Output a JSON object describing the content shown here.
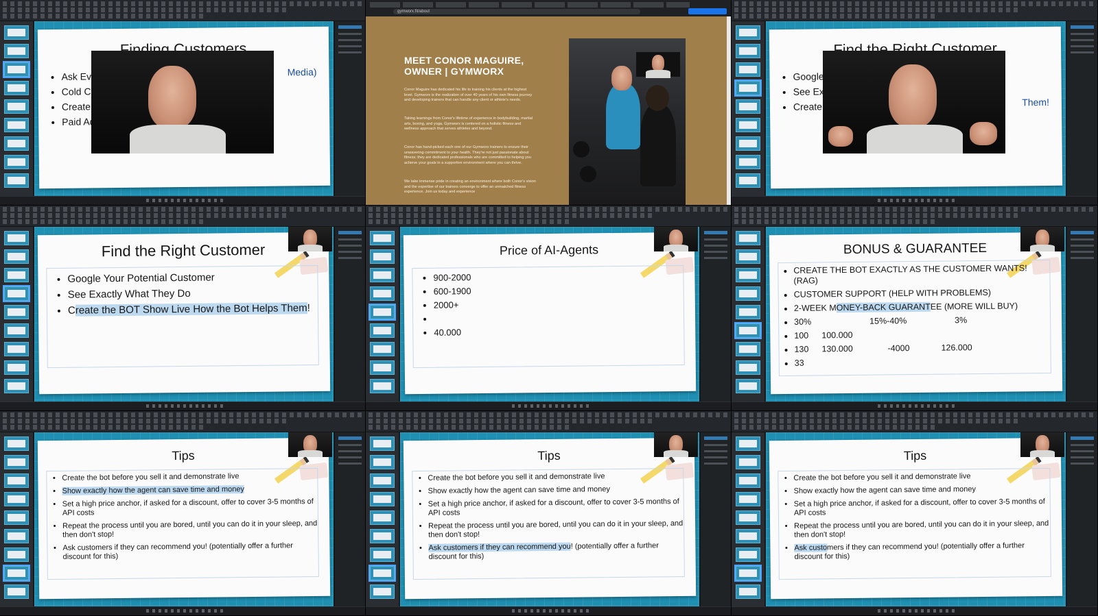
{
  "tiles": {
    "t1": {
      "title": "Finding Customers",
      "bullets": [
        "Ask Eve",
        "Cold Ca",
        "Create C",
        "Paid Adv"
      ],
      "right_fragment": "Media)"
    },
    "t2": {
      "url": "gymworx.fit/about",
      "heading": "MEET CONOR MAGUIRE, OWNER | GYMWORX",
      "paragraphs": [
        "Conor Maguire has dedicated his life to training his clients at the highest level. Gymworx is the realization of over 40 years of his own fitness journey and developing trainers that can handle any client or athlete's needs.",
        "Taking learnings from Conor's lifetime of experience in bodybuilding, martial arts, boxing, and yoga, Gymworx is centered on a holistic fitness and wellness approach that serves athletes and beyond.",
        "Conor has hand-picked each one of our Gymworx trainers to ensure their unwavering commitment to your health. They're not just passionate about fitness; they are dedicated professionals who are committed to helping you achieve your goals in a supportive environment where you can thrive.",
        "We take immense pride in creating an environment where both Conor's vision and the expertise of our trainers converge to offer an unmatched fitness experience. Join us today and experience"
      ]
    },
    "t3": {
      "title": "Find the Right Customer",
      "bullets": [
        "Google",
        "See Exa",
        "Create"
      ],
      "right_fragment": "Them!"
    },
    "t4": {
      "title": "Find the Right Customer",
      "bullets": [
        "Google Your Potential Customer",
        "See Exactly What They Do"
      ],
      "b3_pre": "C",
      "b3_hl": "reate the BOT Show Live How the Bot Helps Them",
      "b3_post": "!"
    },
    "t5": {
      "title": "Price of AI-Agents",
      "bullets": [
        "900-2000",
        "600-1900",
        "2000+",
        "",
        "40.000"
      ]
    },
    "t6": {
      "title": "BONUS & GUARANTEE",
      "l1": "CREATE THE BOT EXACTLY AS THE CUSTOMER WANTS! (RAG)",
      "l2": "CUSTOMER SUPPORT (HELP WITH PROBLEMS)",
      "l3_pre": "2-WEEK M",
      "l3_hl": "ONEY-BACK GUARANT",
      "l3_post": "EE (MORE WILL BUY)",
      "r4": [
        "30%",
        "15%-40%",
        "3%"
      ],
      "r5": [
        "100",
        "100.000"
      ],
      "r6": [
        "130",
        "130.000",
        "-4000",
        "126.000"
      ],
      "r7": [
        "33"
      ]
    },
    "tips": {
      "title": "Tips",
      "items": [
        "Create the bot before you sell it and demonstrate live",
        "Show exactly how the agent can save time and money",
        "Set a high price anchor, if asked for a discount, offer to cover 3-5 months of API costs",
        "Repeat the process until you are bored, until you can do it in your sleep, and then don't stop!",
        "Ask customers if they can recommend you! (potentially offer a further discount for this)"
      ],
      "t8_last_hl": "Ask customers if they can recommend you",
      "t8_last_rest": "! (potentially offer a further discount for this)",
      "t9_last_hl": "Ask custo",
      "t9_last_rest": "mers if they can recommend you! (potentially offer a further discount for this)"
    }
  },
  "colors": {
    "canvas": "#1f8fb2",
    "highlight": "#bcd9f0",
    "web_bg": "#a17f4a"
  }
}
